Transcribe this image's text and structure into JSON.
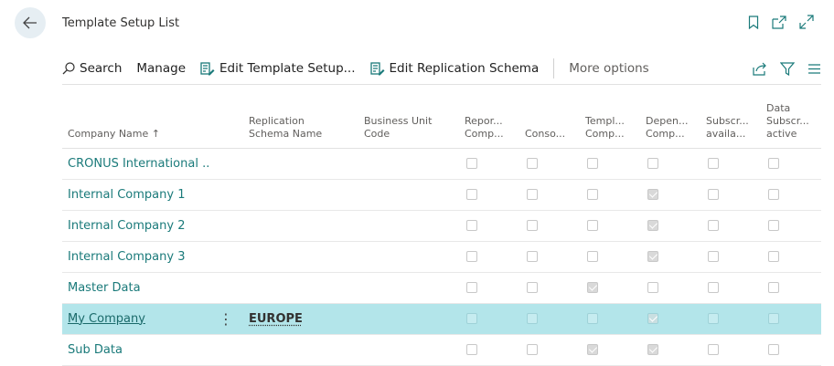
{
  "header": {
    "title": "Template Setup List"
  },
  "toolbar": {
    "search_label": "Search",
    "manage_label": "Manage",
    "edit_template_label": "Edit Template Setup...",
    "edit_replication_label": "Edit Replication Schema",
    "more_options_label": "More options"
  },
  "columns": {
    "company_name": "Company Name ↑",
    "replication_l1": "Replication",
    "replication_l2": "Schema Name",
    "business_l1": "Business Unit",
    "business_l2": "Code",
    "report_l1": "Repor...",
    "report_l2": "Comp...",
    "conso": "Conso...",
    "templ_l1": "Templ...",
    "templ_l2": "Comp...",
    "depen_l1": "Depen...",
    "depen_l2": "Comp...",
    "subscr_l1": "Subscr...",
    "subscr_l2": "availa...",
    "data_l1": "Data",
    "data_l2": "Subscr...",
    "data_l3": "active"
  },
  "rows": [
    {
      "name": "CRONUS International ...",
      "replication": "",
      "business_unit": "",
      "checks": [
        false,
        false,
        false,
        false,
        false,
        false
      ]
    },
    {
      "name": "Internal Company 1",
      "replication": "",
      "business_unit": "",
      "checks": [
        false,
        false,
        false,
        true,
        false,
        false
      ]
    },
    {
      "name": "Internal Company 2",
      "replication": "",
      "business_unit": "",
      "checks": [
        false,
        false,
        false,
        true,
        false,
        false
      ]
    },
    {
      "name": "Internal Company 3",
      "replication": "",
      "business_unit": "",
      "checks": [
        false,
        false,
        false,
        true,
        false,
        false
      ]
    },
    {
      "name": "Master Data",
      "replication": "",
      "business_unit": "",
      "checks": [
        false,
        false,
        true,
        false,
        false,
        false
      ]
    },
    {
      "name": "My Company",
      "menu": "⋮",
      "replication": "EUROPE",
      "business_unit": "",
      "selected": true,
      "checks": [
        false,
        false,
        false,
        true,
        false,
        false
      ]
    },
    {
      "name": "Sub Data",
      "replication": "",
      "business_unit": "",
      "checks": [
        false,
        false,
        true,
        true,
        false,
        false
      ]
    }
  ],
  "colors": {
    "accent": "#1a7a7a",
    "selected_row": "#b3e5ea"
  }
}
